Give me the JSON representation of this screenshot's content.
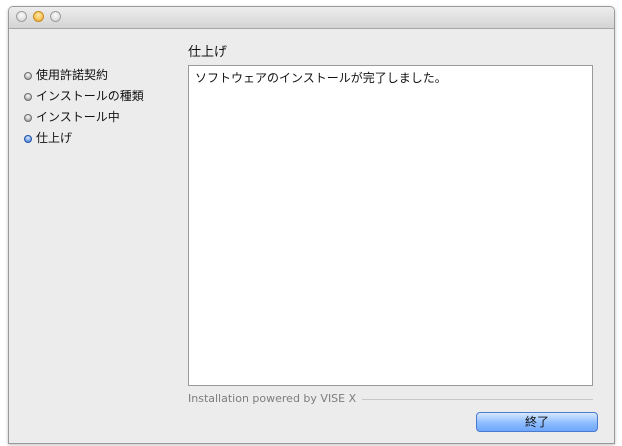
{
  "window": {
    "traffic_lights": [
      "close",
      "minimize",
      "zoom"
    ],
    "accent_color": "#2f6fd6"
  },
  "sidebar": {
    "steps": [
      {
        "label": "使用許諾契約",
        "active": false
      },
      {
        "label": "インストールの種類",
        "active": false
      },
      {
        "label": "インストール中",
        "active": false
      },
      {
        "label": "仕上げ",
        "active": true
      }
    ]
  },
  "main": {
    "title": "仕上げ",
    "message": "ソフトウェアのインストールが完了しました。"
  },
  "footer": {
    "powered_by": "Installation powered by VISE X",
    "finish_label": "終了"
  }
}
